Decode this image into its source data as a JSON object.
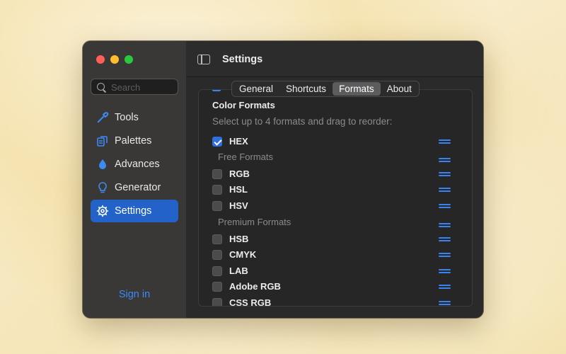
{
  "sidebar": {
    "search_placeholder": "Search",
    "items": [
      {
        "label": "Tools",
        "icon": "eyedropper-icon"
      },
      {
        "label": "Palettes",
        "icon": "palettes-icon"
      },
      {
        "label": "Advances",
        "icon": "drop-icon"
      },
      {
        "label": "Generator",
        "icon": "lightbulb-icon"
      },
      {
        "label": "Settings",
        "icon": "gear-icon",
        "active": true
      }
    ],
    "signin": "Sign in"
  },
  "header": {
    "title": "Settings"
  },
  "tabs": [
    {
      "label": "General"
    },
    {
      "label": "Shortcuts"
    },
    {
      "label": "Formats",
      "selected": true
    },
    {
      "label": "About"
    }
  ],
  "formats": {
    "heading": "Color Formats",
    "subtitle": "Select up to 4 formats and drag to reorder:",
    "rows": [
      {
        "kind": "format",
        "name": "HEX",
        "checked": true
      },
      {
        "kind": "group",
        "name": "Free Formats"
      },
      {
        "kind": "format",
        "name": "RGB",
        "checked": false
      },
      {
        "kind": "format",
        "name": "HSL",
        "checked": false
      },
      {
        "kind": "format",
        "name": "HSV",
        "checked": false
      },
      {
        "kind": "group",
        "name": "Premium Formats"
      },
      {
        "kind": "format",
        "name": "HSB",
        "checked": false
      },
      {
        "kind": "format",
        "name": "CMYK",
        "checked": false
      },
      {
        "kind": "format",
        "name": "LAB",
        "checked": false
      },
      {
        "kind": "format",
        "name": "Adobe RGB",
        "checked": false
      },
      {
        "kind": "format",
        "name": "CSS RGB",
        "checked": false
      }
    ]
  },
  "colors": {
    "accent": "#2362c8",
    "link": "#3d8af7",
    "drag_handle": "#3a82f0"
  }
}
